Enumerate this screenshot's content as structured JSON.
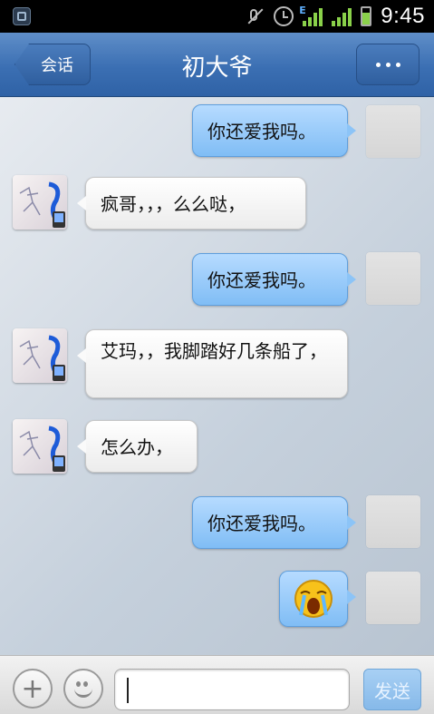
{
  "status_bar": {
    "time": "9:45",
    "signal_type": "E",
    "icons": [
      "app-icon",
      "mute-icon",
      "alarm-icon",
      "signal-e-icon",
      "signal-icon",
      "battery-icon"
    ]
  },
  "header": {
    "back_label": "会话",
    "title": "初大爷",
    "more_label": "•••"
  },
  "messages": [
    {
      "sender": "me",
      "text": "你还爱我吗。"
    },
    {
      "sender": "them",
      "text": "疯哥，，，么么哒，"
    },
    {
      "sender": "me",
      "text": "你还爱我吗。"
    },
    {
      "sender": "them",
      "text": "艾玛，，我脚踏好几条船了，"
    },
    {
      "sender": "them",
      "text": "怎么办，"
    },
    {
      "sender": "me",
      "text": "你还爱我吗。"
    },
    {
      "sender": "me",
      "text": "",
      "sticker": "crying-emoji"
    }
  ],
  "input_bar": {
    "plus_label": "+",
    "text_value": "",
    "send_label": "发送"
  },
  "colors": {
    "title_bar": "#3b6fb3",
    "my_bubble": "#9ccbf8",
    "their_bubble": "#ffffff",
    "send_button": "#8ec0ee"
  }
}
